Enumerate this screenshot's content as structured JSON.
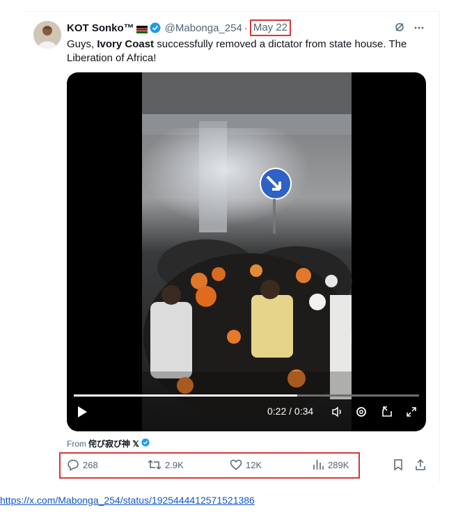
{
  "tweet": {
    "display_name": "KOT Sonko™",
    "handle": "@Mabonga_254",
    "separator": "·",
    "date": "May 22",
    "text_before": "Guys, ",
    "text_bold": "Ivory Coast",
    "text_after": " successfully removed a dictator from state house. The Liberation of Africa!"
  },
  "video": {
    "time": "0:22 / 0:34",
    "progress": 0.647
  },
  "source": {
    "from_label": "From",
    "from_name": "侘び寂び神 𝕏"
  },
  "actions": {
    "replies": "268",
    "reposts": "2.9K",
    "likes": "12K",
    "views": "289K"
  },
  "link": {
    "url": "https://x.com/Mabonga_254/status/1925444412571521386"
  },
  "colors": {
    "highlight": "#d93636",
    "verified": "#1d9bf0",
    "muted": "#536471"
  }
}
